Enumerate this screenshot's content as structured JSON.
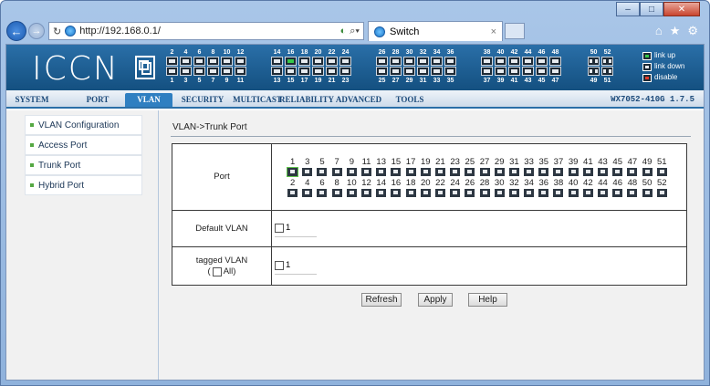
{
  "browser": {
    "address": "http://192.168.0.1/",
    "tab_title": "Switch",
    "back_icon": "back-arrow-icon",
    "forward_icon": "forward-arrow-icon"
  },
  "device": {
    "logo": "ICCN",
    "version": "WX7052-410G 1.7.5",
    "legend": {
      "up": "link up",
      "down": "link down",
      "disable": "disable"
    },
    "port_groups": [
      {
        "top": [
          "2",
          "4",
          "6",
          "8",
          "10",
          "12"
        ],
        "bottom": [
          "1",
          "3",
          "5",
          "7",
          "9",
          "11"
        ]
      },
      {
        "top": [
          "14",
          "16",
          "18",
          "20",
          "22",
          "24"
        ],
        "bottom": [
          "13",
          "15",
          "17",
          "19",
          "21",
          "23"
        ]
      },
      {
        "top": [
          "26",
          "28",
          "30",
          "32",
          "34",
          "36"
        ],
        "bottom": [
          "25",
          "27",
          "29",
          "31",
          "33",
          "35"
        ]
      },
      {
        "top": [
          "38",
          "40",
          "42",
          "44",
          "46",
          "48"
        ],
        "bottom": [
          "37",
          "39",
          "41",
          "43",
          "45",
          "47"
        ]
      },
      {
        "top": [
          "50",
          "52"
        ],
        "bottom": [
          "49",
          "51"
        ]
      }
    ],
    "link_up_port": "16",
    "colors": {
      "header": "#1e5f96",
      "link_up": "#37c84a",
      "disable": "#e23a2a"
    }
  },
  "menu": {
    "items": [
      "SYSTEM",
      "PORT",
      "VLAN",
      "SECURITY",
      "MULTICAST",
      "RELIABILITY",
      "ADVANCED",
      "TOOLS"
    ],
    "active": "VLAN"
  },
  "sidebar": {
    "items": [
      "VLAN Configuration",
      "Access Port",
      "Trunk Port",
      "Hybrid Port"
    ]
  },
  "main": {
    "breadcrumb": "VLAN->Trunk Port",
    "port_label": "Port",
    "ports_odd": [
      "1",
      "3",
      "5",
      "7",
      "9",
      "11",
      "13",
      "15",
      "17",
      "19",
      "21",
      "23",
      "25",
      "27",
      "29",
      "31",
      "33",
      "35",
      "37",
      "39",
      "41",
      "43",
      "45",
      "47",
      "49",
      "51"
    ],
    "ports_even": [
      "2",
      "4",
      "6",
      "8",
      "10",
      "12",
      "14",
      "16",
      "18",
      "20",
      "22",
      "24",
      "26",
      "28",
      "30",
      "32",
      "34",
      "36",
      "38",
      "40",
      "42",
      "44",
      "46",
      "48",
      "50",
      "52"
    ],
    "selected_port": "1",
    "default_vlan_label": "Default VLAN",
    "default_vlan_option": "1",
    "tagged_vlan_label": "tagged VLAN",
    "all_open": "(",
    "all_label": "All)",
    "tagged_vlan_option": "1",
    "buttons": {
      "refresh": "Refresh",
      "apply": "Apply",
      "help": "Help"
    }
  }
}
